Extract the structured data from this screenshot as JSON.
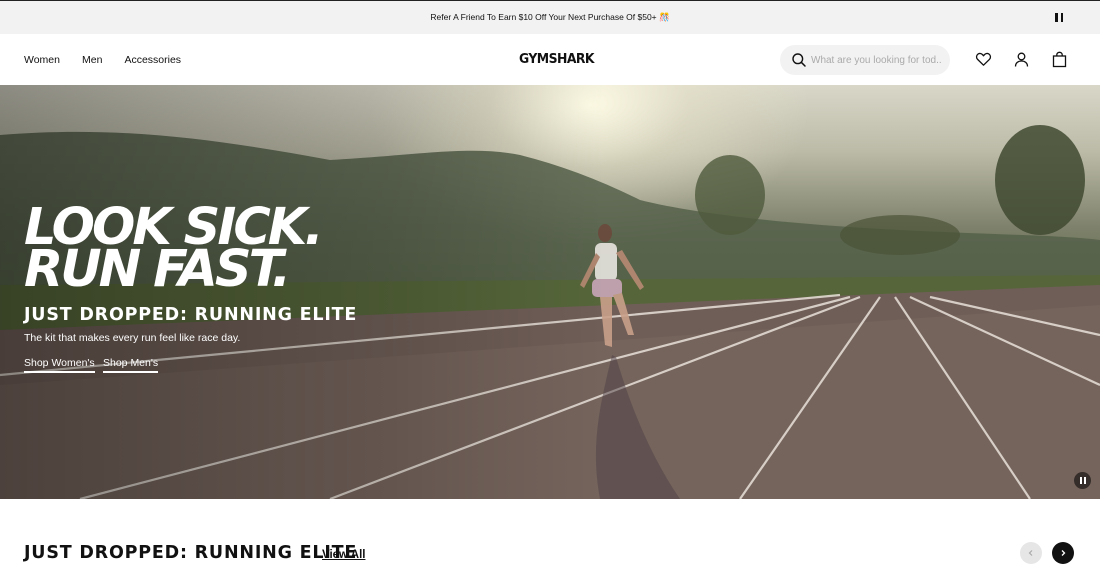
{
  "announcement": {
    "text": "Refer A Friend To Earn $10 Off Your Next Purchase Of $50+ 🎊",
    "icon": "pause-icon"
  },
  "nav": {
    "links": [
      "Women",
      "Men",
      "Accessories"
    ],
    "logo": "GYMSHARK",
    "search": {
      "placeholder": "What are you looking for tod...",
      "value": "",
      "icon": "search-icon"
    },
    "icons": [
      "heart-icon",
      "user-icon",
      "bag-icon"
    ]
  },
  "hero": {
    "headline": [
      "LOOK SICK.",
      "RUN FAST."
    ],
    "subheading": "JUST DROPPED: RUNNING ELITE",
    "description": "The kit that makes every run feel like race day.",
    "ctas": [
      "Shop Women's",
      "Shop Men's"
    ],
    "video_control_icon": "pause-icon"
  },
  "section": {
    "title": "JUST DROPPED: RUNNING ELITE",
    "link": "View All",
    "carousel_icons": [
      "chevron-left-icon",
      "chevron-right-icon"
    ]
  },
  "colors": {
    "text": "#111111",
    "announcement_bg": "#f2f2f2",
    "search_bg": "#f2f2f2",
    "hero_text": "#ffffff",
    "carousel_active": "#111111"
  }
}
